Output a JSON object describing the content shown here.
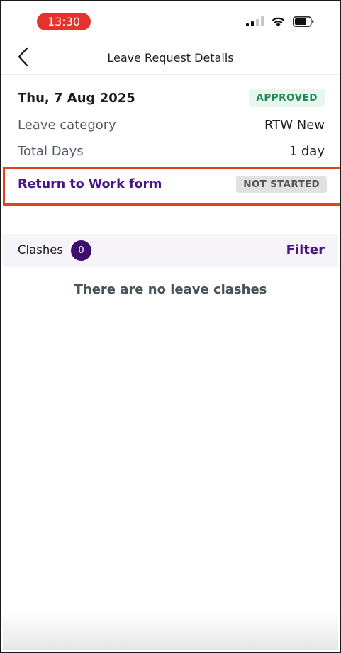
{
  "status_bar": {
    "time": "13:30",
    "icons": [
      "signal-icon",
      "wifi-icon",
      "battery-icon"
    ],
    "accent_color": "#e5322d"
  },
  "nav": {
    "back_icon": "chevron-left-icon",
    "title": "Leave Request Details"
  },
  "leave": {
    "date": "Thu, 7 Aug 2025",
    "status": "APPROVED",
    "status_color": "#1e8a5a",
    "category_label": "Leave category",
    "category_value": "RTW New",
    "total_days_label": "Total Days",
    "total_days_value": "1 day"
  },
  "rtw": {
    "link_label": "Return to Work form",
    "status": "NOT STARTED",
    "highlight_color": "#e4411b"
  },
  "clashes": {
    "label": "Clashes",
    "count": "0",
    "filter_label": "Filter",
    "empty_message": "There are no leave clashes"
  },
  "brand_color": "#4b1384"
}
